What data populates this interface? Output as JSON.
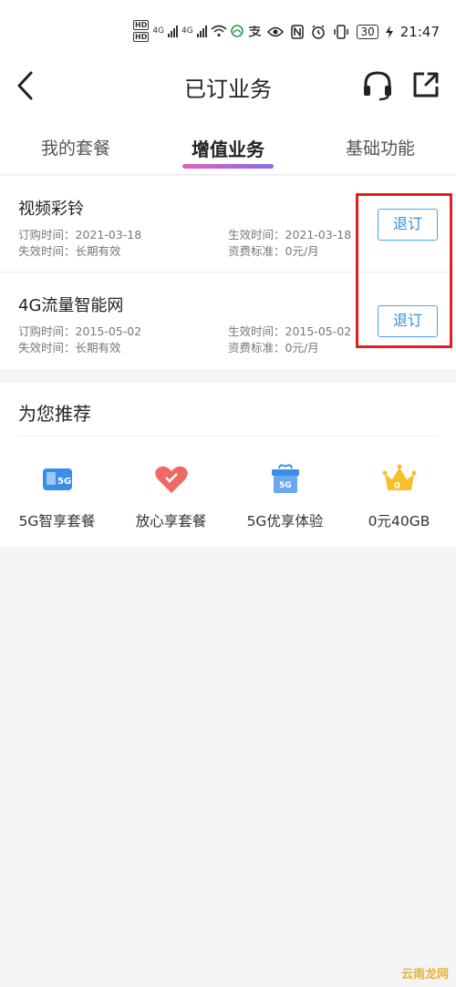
{
  "status_bar": {
    "hd1": "HD",
    "hd2": "HD",
    "net1": "4G",
    "net2": "4G",
    "battery": "30",
    "time": "21:47"
  },
  "header": {
    "title": "已订业务"
  },
  "tabs": [
    {
      "label": "我的套餐"
    },
    {
      "label": "增值业务"
    },
    {
      "label": "基础功能"
    }
  ],
  "subscriptions": [
    {
      "name": "视频彩铃",
      "order_time": "订购时间：2021-03-18",
      "expire_time": "失效时间：长期有效",
      "effective_time": "生效时间：2021-03-18",
      "fee": "资费标准：0元/月",
      "action": "退订"
    },
    {
      "name": "4G流量智能网",
      "order_time": "订购时间：2015-05-02",
      "expire_time": "失效时间：长期有效",
      "effective_time": "生效时间：2015-05-02",
      "fee": "资费标准：0元/月",
      "action": "退订"
    }
  ],
  "recommend": {
    "title": "为您推荐",
    "items": [
      {
        "label": "5G智享套餐",
        "icon": "sim-5g-icon"
      },
      {
        "label": "放心享套餐",
        "icon": "heart-icon"
      },
      {
        "label": "5G优享体验",
        "icon": "gift-box-icon"
      },
      {
        "label": "0元40GB",
        "icon": "crown-icon"
      }
    ]
  },
  "watermark": "云南龙网",
  "colors": {
    "accent_blue": "#2f8fdc",
    "highlight_red": "#e02020",
    "tab_gradient_start": "#e060c0",
    "tab_gradient_end": "#8a6be8"
  }
}
